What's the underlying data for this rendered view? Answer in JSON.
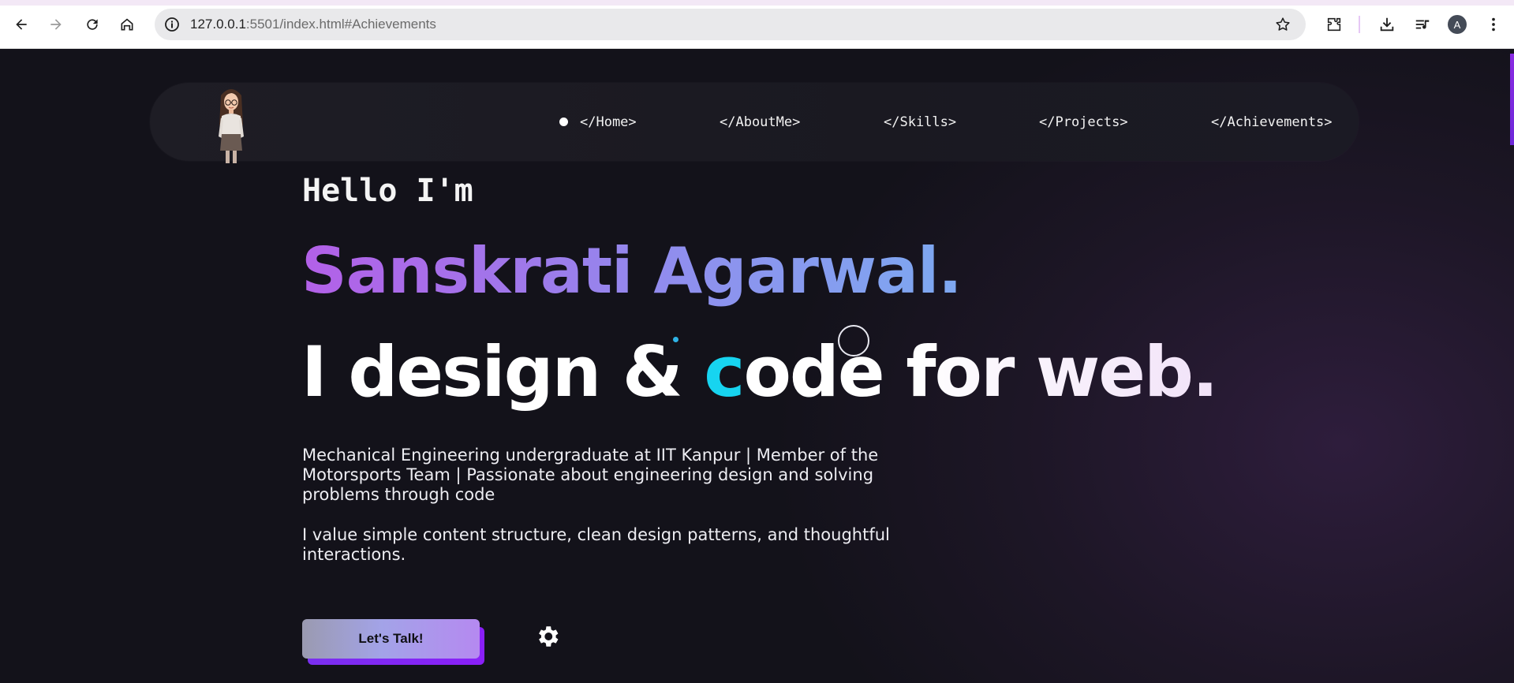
{
  "browser": {
    "url_host": "127.0.0.1",
    "url_rest": ":5501/index.html#Achievements",
    "profile_initial": "A",
    "icons": [
      "back-icon",
      "forward-icon",
      "reload-icon",
      "home-icon",
      "site-info-icon",
      "bookmark-star-icon",
      "extensions-icon",
      "download-icon",
      "media-control-icon",
      "profile-avatar",
      "menu-kebab-icon"
    ]
  },
  "nav": {
    "links": [
      "</Home>",
      "</AboutMe>",
      "</Skills>",
      "</Projects>",
      "</Achievements>"
    ]
  },
  "hero": {
    "greeting": "Hello I'm",
    "name": "Sanskrati Agarwal",
    "name_dot": ".",
    "tagline_part1": "I design & ",
    "tagline_highlight": "c",
    "tagline_part2": "ode ",
    "tagline_part3": "for web.",
    "bio_1": "Mechanical Engineering undergraduate at IIT Kanpur | Member of the Motorsports Team | Passionate about engineering design and solving problems through code",
    "bio_2": "I value simple content structure, clean design patterns, and thoughtful interactions.",
    "cta_label": "Let's Talk!"
  },
  "colors": {
    "background": "#13121a",
    "name_gradient_start": "#b360e8",
    "name_gradient_end": "#7ea7f0",
    "highlight_cyan": "#17d4f0",
    "cta_shadow": "#7a2ff0",
    "scroll_accent": "#8a2be2"
  }
}
